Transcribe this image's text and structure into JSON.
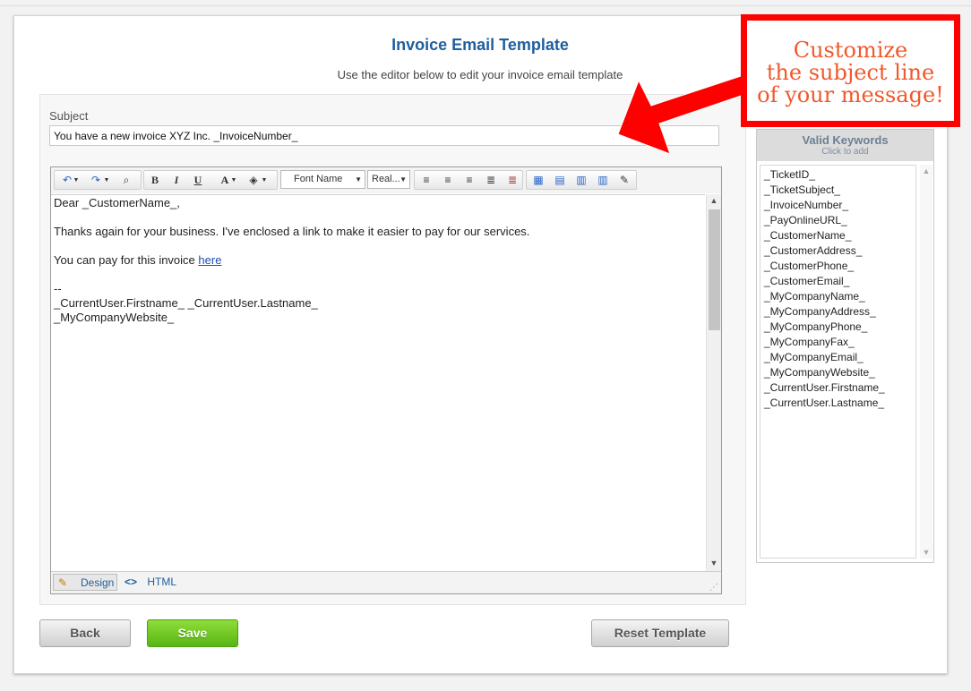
{
  "header": {
    "title": "Invoice Email Template",
    "subtitle": "Use the editor below to edit your invoice email template"
  },
  "subject": {
    "label": "Subject",
    "value": "You have a new invoice XYZ Inc. _InvoiceNumber_"
  },
  "toolbar": {
    "font_name": "Font Name",
    "font_size": "Real..."
  },
  "editor": {
    "line1": "Dear _CustomerName_,",
    "line2": "Thanks again for your business. I've enclosed a link to make it easier to pay for our services.",
    "line3_prefix": "You can pay for this invoice ",
    "line3_link": "here",
    "line4": "--",
    "line5": "_CurrentUser.Firstname_ _CurrentUser.Lastname_",
    "line6": "_MyCompanyWebsite_",
    "mode_design": "Design",
    "mode_html": "HTML"
  },
  "keywords": {
    "title": "Valid Keywords",
    "hint": "Click to add",
    "items": [
      "_TicketID_",
      "_TicketSubject_",
      "_InvoiceNumber_",
      "_PayOnlineURL_",
      "_CustomerName_",
      "_CustomerAddress_",
      "_CustomerPhone_",
      "_CustomerEmail_",
      "_MyCompanyName_",
      "_MyCompanyAddress_",
      "_MyCompanyPhone_",
      "_MyCompanyFax_",
      "_MyCompanyEmail_",
      "_MyCompanyWebsite_",
      "_CurrentUser.Firstname_",
      "_CurrentUser.Lastname_"
    ]
  },
  "buttons": {
    "back": "Back",
    "save": "Save",
    "reset": "Reset Template"
  },
  "callout": {
    "line1": "Customize",
    "line2": "the subject line",
    "line3": "of your message!",
    "border_color": "#ff0000",
    "text_color": "#f0582a"
  },
  "colors": {
    "title": "#1f5f9e",
    "save_green": "#66c11f"
  }
}
